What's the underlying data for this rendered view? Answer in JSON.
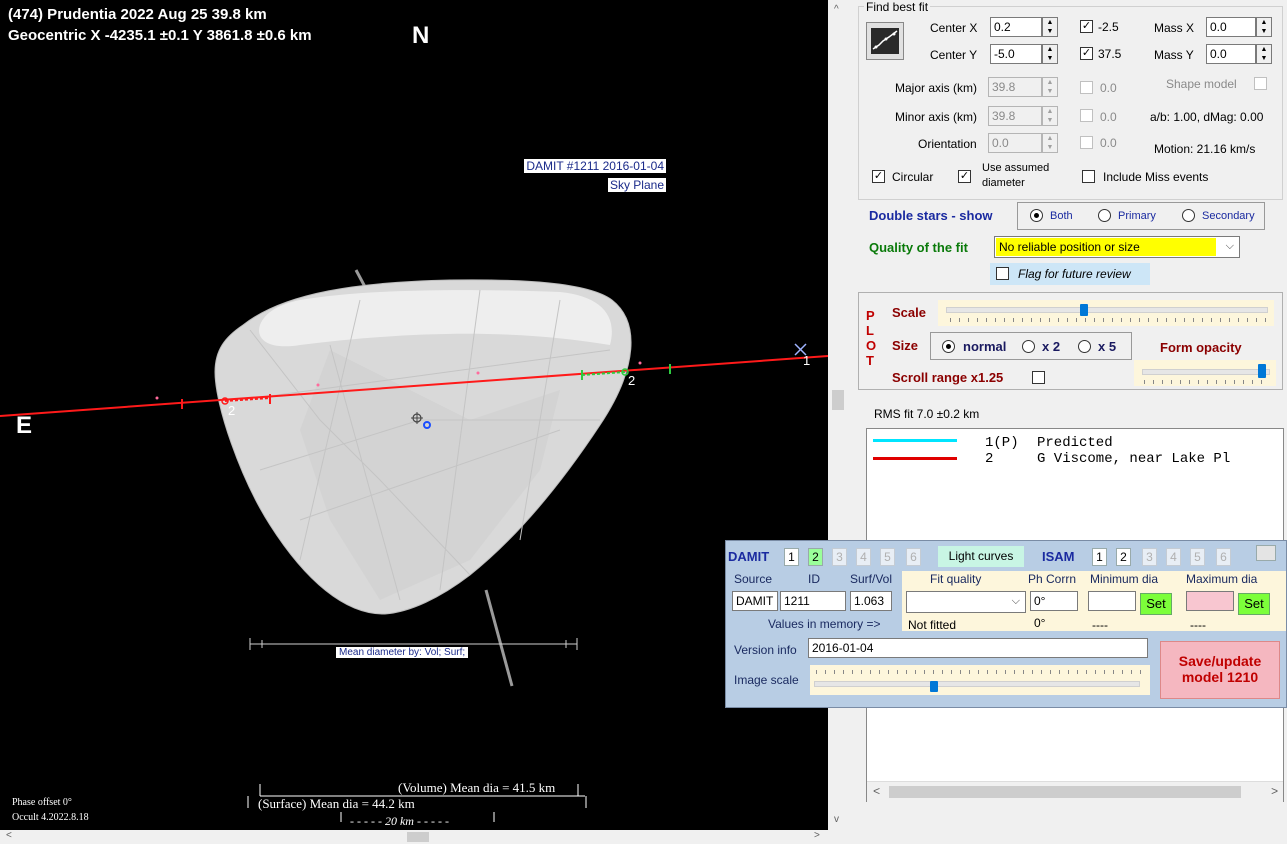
{
  "plot": {
    "title_line1": "(474) Prudentia  2022 Aug 25  39.8 km",
    "title_line2": "Geocentric X  -4235.1 ±0.1  Y 3861.8 ±0.6 km",
    "north_label": "N",
    "east_label": "E",
    "damit_tag_line1": "DAMIT #1211 2016-01-04",
    "damit_tag_line2": "Sky Plane",
    "chord_label_left": "2",
    "chord_label_right": "2",
    "predicted_label": "1",
    "mean_diameter_label": "Mean diameter by: Vol; Surf;",
    "volume_mean": "(Volume) Mean dia = 41.5 km",
    "surface_mean": "(Surface) Mean dia = 44.2 km",
    "scale_bar": "20 km",
    "phase_offset": "Phase offset 0°",
    "version": "Occult 4.2022.8.18"
  },
  "fit": {
    "group_title": "Find best fit",
    "center_x_label": "Center X",
    "center_x_value": "0.2",
    "center_x_check": "-2.5",
    "center_y_label": "Center Y",
    "center_y_value": "-5.0",
    "center_y_check": "37.5",
    "mass_x_label": "Mass X",
    "mass_x_value": "0.0",
    "mass_y_label": "Mass Y",
    "mass_y_value": "0.0",
    "major_label": "Major axis (km)",
    "major_value": "39.8",
    "major_check": "0.0",
    "minor_label": "Minor axis (km)",
    "minor_value": "39.8",
    "minor_check": "0.0",
    "orient_label": "Orientation",
    "orient_value": "0.0",
    "orient_check": "0.0",
    "shape_model_label": "Shape model",
    "ab_text": "a/b: 1.00, dMag: 0.00",
    "motion_text": "Motion: 21.16 km/s",
    "circular_label": "Circular",
    "assumed_label_1": "Use assumed",
    "assumed_label_2": "diameter",
    "miss_label": "Include Miss events",
    "double_label": "Double stars - show",
    "radio_both": "Both",
    "radio_primary": "Primary",
    "radio_secondary": "Secondary",
    "quality_label": "Quality of the fit",
    "quality_value": "No reliable position or size",
    "flag_label": "Flag for future review"
  },
  "plotpanel": {
    "side_letters": [
      "P",
      "L",
      "O",
      "T"
    ],
    "scale_label": "Scale",
    "size_label": "Size",
    "size_normal": "normal",
    "size_x2": "x 2",
    "size_x5": "x 5",
    "form_opacity": "Form opacity",
    "scroll_range": "Scroll range x1.25",
    "scale_slider_level": 0.43,
    "opacity_slider_level": 0.95
  },
  "rms": "RMS fit 7.0 ±0.2 km",
  "legend": [
    {
      "num": "1(P)",
      "text": "Predicted",
      "color": "#00e5ff"
    },
    {
      "num": "2",
      "text": "G Viscome, near Lake Pl",
      "color": "#e00000"
    }
  ],
  "damit": {
    "title": "DAMIT",
    "damit_nums": [
      "1",
      "2",
      "3",
      "4",
      "5",
      "6"
    ],
    "light_curves": "Light curves",
    "isam": "ISAM",
    "isam_nums": [
      "1",
      "2",
      "3",
      "4",
      "5",
      "6"
    ],
    "col_source": "Source",
    "col_id": "ID",
    "col_surfvol": "Surf/Vol",
    "col_fit": "Fit quality",
    "col_phcorr": "Ph Corrn",
    "col_min": "Minimum dia",
    "col_max": "Maximum dia",
    "source_value": "DAMIT",
    "id_value": "1211",
    "surfvol_value": "1.063",
    "phcorr_value": "0°",
    "set_label": "Set",
    "values_memory": "Values in memory =>",
    "not_fitted": "Not fitted",
    "mem_phcorr": "0°",
    "mem_min": "----",
    "mem_max": "----",
    "version_label": "Version info",
    "version_value": "2016-01-04",
    "image_scale_label": "Image scale",
    "image_scale_level": 0.37,
    "save_line1": "Save/update",
    "save_line2": "model 1210"
  },
  "colors": {
    "chord_red": "#ff1a1a",
    "predicted_cyan": "#00e5ff",
    "quality_yellow": "#ffff00",
    "save_pink": "#f5b7c0",
    "set_green": "#7cff3a"
  }
}
